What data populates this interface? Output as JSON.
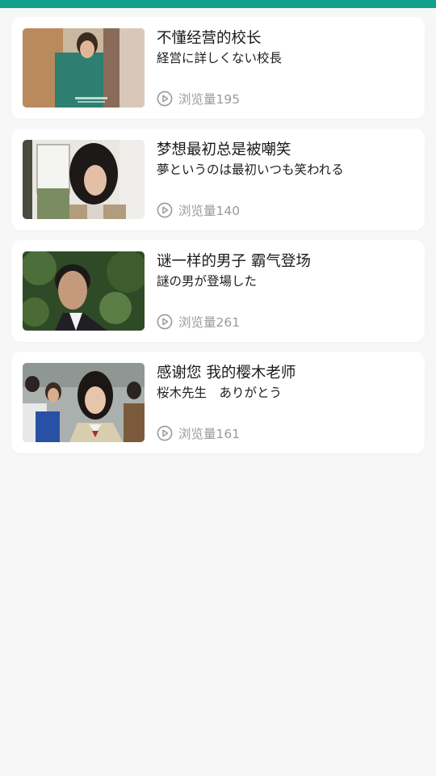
{
  "colors": {
    "status_bar": "#12a08a",
    "page_background": "#f7f7f7",
    "card_background": "#ffffff",
    "title_text": "#1a1a1a",
    "views_text": "#9a9a9a"
  },
  "videos": [
    {
      "title": "不懂经营的校长",
      "subtitle": "経営に詳しくない校長",
      "views": "浏览量195",
      "thumbnail_icon": "video-thumbnail-icon"
    },
    {
      "title": "梦想最初总是被嘲笑",
      "subtitle": "夢というのは最初いつも笑われる",
      "views": "浏览量140",
      "thumbnail_icon": "video-thumbnail-icon"
    },
    {
      "title": "谜一样的男子 霸气登场",
      "subtitle": "謎の男が登場した",
      "views": "浏览量261",
      "thumbnail_icon": "video-thumbnail-icon"
    },
    {
      "title": "感谢您 我的樱木老师",
      "subtitle": "桜木先生　ありがとう",
      "views": "浏览量161",
      "thumbnail_icon": "video-thumbnail-icon"
    }
  ]
}
